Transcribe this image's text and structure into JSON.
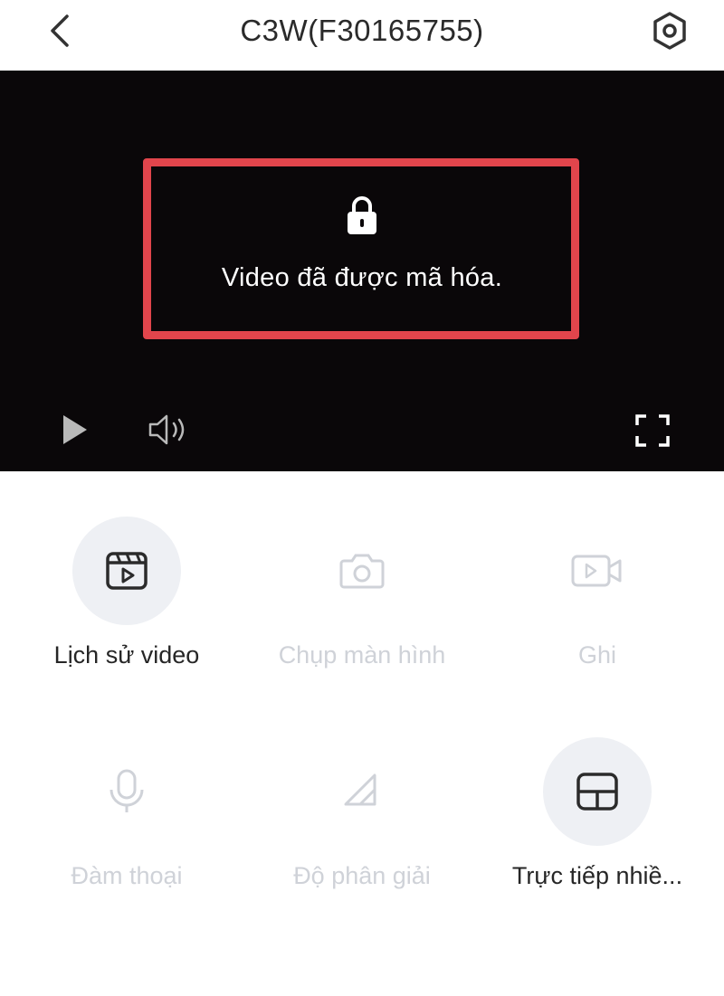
{
  "header": {
    "title": "C3W(F30165755)",
    "back_icon": "chevron-left-icon",
    "settings_icon": "hexagon-gear-icon"
  },
  "video": {
    "message": "Video đã được mã hóa.",
    "lock_icon": "lock-icon",
    "highlight_color": "#e1454c",
    "controls": {
      "play_icon": "play-icon",
      "volume_icon": "volume-icon",
      "fullscreen_icon": "fullscreen-icon"
    }
  },
  "actions": [
    {
      "label": "Lịch sử video",
      "icon": "video-history-icon",
      "enabled": true
    },
    {
      "label": "Chụp màn hình",
      "icon": "camera-icon",
      "enabled": false
    },
    {
      "label": "Ghi",
      "icon": "record-video-icon",
      "enabled": false
    },
    {
      "label": "Đàm thoại",
      "icon": "microphone-icon",
      "enabled": false
    },
    {
      "label": "Độ phân giải",
      "icon": "resolution-icon",
      "enabled": false
    },
    {
      "label": "Trực tiếp nhiề...",
      "icon": "multi-view-grid-icon",
      "enabled": true
    }
  ],
  "colors": {
    "video_background": "#0a0709",
    "active_text": "#262626",
    "disabled_text": "#cfd2d8",
    "circle_fill": "#eef0f4"
  }
}
